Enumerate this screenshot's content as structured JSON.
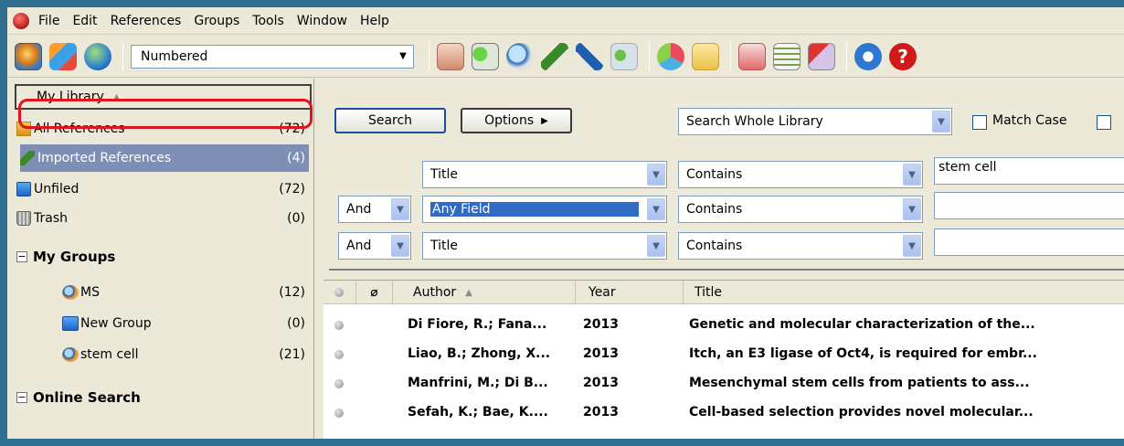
{
  "menu": {
    "items": [
      "File",
      "Edit",
      "References",
      "Groups",
      "Tools",
      "Window",
      "Help"
    ]
  },
  "toolbar": {
    "style_value": "Numbered"
  },
  "library": {
    "header": "My Library",
    "items": [
      {
        "label": "All References",
        "count": "(72)"
      },
      {
        "label": "Imported References",
        "count": "(4)"
      },
      {
        "label": "Unfiled",
        "count": "(72)"
      },
      {
        "label": "Trash",
        "count": "(0)"
      }
    ],
    "groups_header": "My Groups",
    "groups": [
      {
        "label": "MS",
        "count": "(12)"
      },
      {
        "label": "New Group",
        "count": "(0)"
      },
      {
        "label": "stem cell",
        "count": "(21)"
      }
    ],
    "online_header": "Online Search"
  },
  "search": {
    "search_button": "Search",
    "options_button": "Options",
    "scope": "Search Whole Library",
    "match_case": "Match Case",
    "rows": [
      {
        "bool": "",
        "field": "Title",
        "op": "Contains",
        "value": "stem cell"
      },
      {
        "bool": "And",
        "field": "Any Field",
        "op": "Contains",
        "value": ""
      },
      {
        "bool": "And",
        "field": "Title",
        "op": "Contains",
        "value": ""
      }
    ]
  },
  "results": {
    "columns": {
      "author": "Author",
      "year": "Year",
      "title": "Title"
    },
    "rows": [
      {
        "author": "Di Fiore, R.; Fana...",
        "year": "2013",
        "title": "Genetic and molecular characterization of the..."
      },
      {
        "author": "Liao, B.; Zhong, X...",
        "year": "2013",
        "title": "Itch, an E3 ligase of Oct4, is required for embr..."
      },
      {
        "author": "Manfrini, M.; Di B...",
        "year": "2013",
        "title": "Mesenchymal stem cells from patients to ass..."
      },
      {
        "author": "Sefah, K.; Bae, K....",
        "year": "2013",
        "title": "Cell-based selection provides novel molecular..."
      }
    ]
  },
  "colors": {
    "selection": "#7d8fb5",
    "highlight_border": "#e0141e",
    "frame": "#2f6f8f"
  }
}
